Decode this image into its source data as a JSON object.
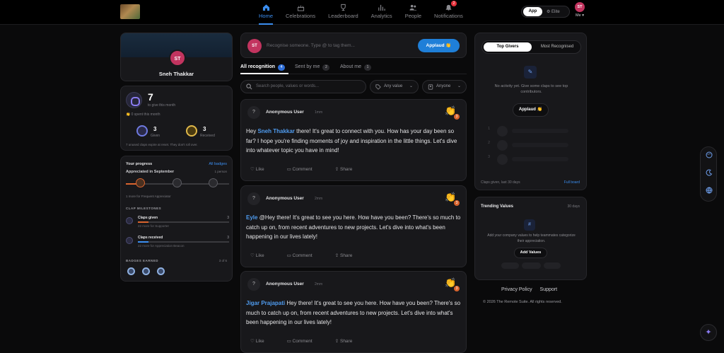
{
  "nav": {
    "items": [
      {
        "label": "Home",
        "icon": "home-icon",
        "active": true
      },
      {
        "label": "Celebrations",
        "icon": "cake-icon"
      },
      {
        "label": "Leaderboard",
        "icon": "trophy-icon"
      },
      {
        "label": "Analytics",
        "icon": "bar-chart-icon"
      },
      {
        "label": "People",
        "icon": "people-icon"
      },
      {
        "label": "Notifications",
        "icon": "bell-icon",
        "badge": "2"
      }
    ],
    "mode_app": "App",
    "mode_elite": "Elite",
    "me_initials": "ST",
    "me_label": "Me ▾"
  },
  "profile": {
    "initials": "ST",
    "name": "Sneh Thakkar"
  },
  "claps": {
    "remaining": "7",
    "remaining_sub": "to give this month",
    "spent": "0 spent this month",
    "given_count": "3",
    "given_label": "Given",
    "received_count": "3",
    "received_label": "Received",
    "note": "7 unused claps expire at reset. They don't roll over."
  },
  "progress": {
    "title": "Your progress",
    "link": "All badges",
    "subtitle": "Appreciated in September",
    "sub_right": "1 person",
    "more": "1 more for Frequent Appreciator",
    "section": "CLAP MILESTONES",
    "milestones": [
      {
        "label": "Claps given",
        "count": "3",
        "note": "22 more for Supporter",
        "fill": 0.12,
        "color": "#d9642e"
      },
      {
        "label": "Claps received",
        "count": "3",
        "note": "22 more for Appreciation Beacon",
        "fill": 0.12,
        "color": "#3b8ef0"
      }
    ],
    "badges_label": "BADGES EARNED",
    "badges_count": "3 of 6"
  },
  "compose": {
    "initials": "ST",
    "placeholder": "Recognise someone. Type @ to tag them...",
    "button": "Applaud 👏"
  },
  "tabs": [
    {
      "label": "All recognition",
      "count": "4",
      "active": true
    },
    {
      "label": "Sent by me",
      "count": "2"
    },
    {
      "label": "About me",
      "count": "1"
    }
  ],
  "search": {
    "placeholder": "Search people, values or words..."
  },
  "filters": {
    "value": "Any value",
    "person": "Anyone"
  },
  "posts": [
    {
      "user": "Anonymous User",
      "time": "1mm",
      "clap_count": "3",
      "mention": "Sneh Thakkar",
      "pre": "Hey ",
      "text": " there! It's great to connect with you. How has your day been so far? I hope you're finding moments of joy and inspiration in the little things. Let's dive into whatever topic you have in mind!",
      "like": "Like",
      "comment": "Comment",
      "share": "Share"
    },
    {
      "user": "Anonymous User",
      "time": "2mm",
      "clap_count": "3",
      "mention": "Eyle",
      "pre": "",
      "text": " @Hey there! It's great to see you here. How have you been? There's so much to catch up on, from recent adventures to new projects. Let's dive into what's been happening in our lives lately!",
      "like": "Like",
      "comment": "Comment",
      "share": "Share"
    },
    {
      "user": "Anonymous User",
      "time": "2mm",
      "clap_count": "3",
      "mention": "Jigar Prajapati",
      "pre": "",
      "text": " Hey there! It's great to see you here. How have you been? There's so much to catch up on, from recent adventures to new projects. Let's dive into what's been happening in our lives lately!",
      "like": "Like",
      "comment": "Comment",
      "share": "Share"
    }
  ],
  "leaders": {
    "tab_on": "Top Givers",
    "tab_off": "Most Recognised",
    "empty": "No activity yet. Give some claps to see top contributors.",
    "button": "Applaud 👏",
    "ranks": [
      "1",
      "2",
      "3"
    ],
    "foot_left": "Claps given, last 30 days",
    "foot_right": "Full board"
  },
  "trending": {
    "title": "Trending Values",
    "days": "30 days",
    "icon": "#",
    "empty": "Add your company values to help teammates categorize their appreciation.",
    "button": "Add Values"
  },
  "footer": {
    "privacy": "Privacy Policy",
    "support": "Support",
    "copyright": "© 2026 The Remote Suite. All rights reserved."
  },
  "colors": {
    "accent": "#3b8ef0",
    "avatar": "#c2345f",
    "clap": "#d9642e"
  }
}
